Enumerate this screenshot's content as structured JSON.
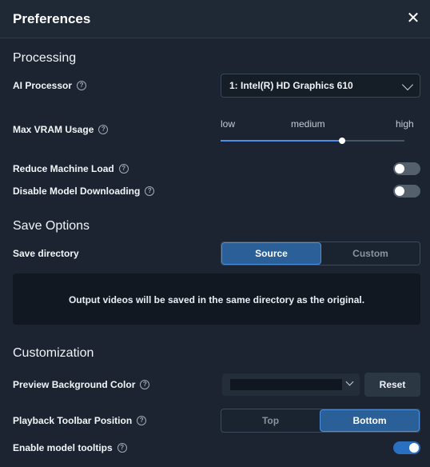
{
  "dialog": {
    "title": "Preferences"
  },
  "processing": {
    "title": "Processing",
    "ai_processor": {
      "label": "AI Processor",
      "value": "1: Intel(R) HD Graphics 610"
    },
    "max_vram": {
      "label": "Max VRAM Usage",
      "low": "low",
      "medium": "medium",
      "high": "high",
      "level": 0.66
    },
    "reduce_load": {
      "label": "Reduce Machine Load",
      "on": false
    },
    "disable_download": {
      "label": "Disable Model Downloading",
      "on": false
    }
  },
  "save_options": {
    "title": "Save Options",
    "directory_label": "Save directory",
    "options": [
      "Source",
      "Custom"
    ],
    "selected": "Source",
    "notice": "Output videos will be saved in the same directory as the original."
  },
  "customization": {
    "title": "Customization",
    "preview_bg": {
      "label": "Preview Background Color",
      "color": "#101720",
      "reset_label": "Reset"
    },
    "toolbar_position": {
      "label": "Playback Toolbar Position",
      "options": [
        "Top",
        "Bottom"
      ],
      "selected": "Bottom"
    },
    "model_tooltips": {
      "label": "Enable model tooltips",
      "on": true
    }
  },
  "colors": {
    "accent": "#2a5f98",
    "toggle_on": "#2b6fc0",
    "background": "#1b2430"
  }
}
